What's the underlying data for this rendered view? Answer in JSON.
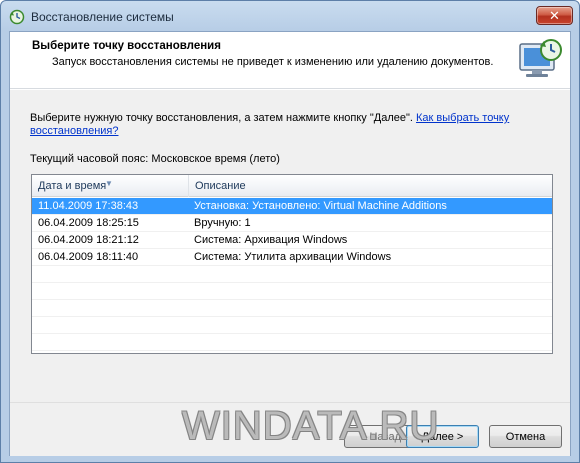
{
  "window": {
    "title": "Восстановление системы",
    "close_label": "✕"
  },
  "header": {
    "title": "Выберите точку восстановления",
    "subtitle": "Запуск восстановления системы не приведет к изменению или удалению документов."
  },
  "instructions": {
    "text": "Выберите нужную точку восстановления, а затем нажмите кнопку \"Далее\".",
    "link": "Как выбрать точку восстановления?"
  },
  "timezone": "Текущий часовой пояс: Московское время (лето)",
  "list": {
    "columns": [
      "Дата и время",
      "Описание"
    ],
    "rows": [
      {
        "date": "11.04.2009 17:38:43",
        "description": "Установка: Установлено: Virtual Machine Additions",
        "selected": true
      },
      {
        "date": "06.04.2009 18:25:15",
        "description": "Вручную: 1",
        "selected": false
      },
      {
        "date": "06.04.2009 18:21:12",
        "description": "Система: Архивация Windows",
        "selected": false
      },
      {
        "date": "06.04.2009 18:11:40",
        "description": "Система: Утилита архивации Windows",
        "selected": false
      }
    ],
    "empty_rows": 6
  },
  "buttons": {
    "back": "< Назад",
    "next": "Далее >",
    "cancel": "Отмена"
  },
  "watermark": "WINDATA.RU",
  "colors": {
    "selection": "#3399ff",
    "link": "#0033cc",
    "close_button": "#c9452d"
  }
}
